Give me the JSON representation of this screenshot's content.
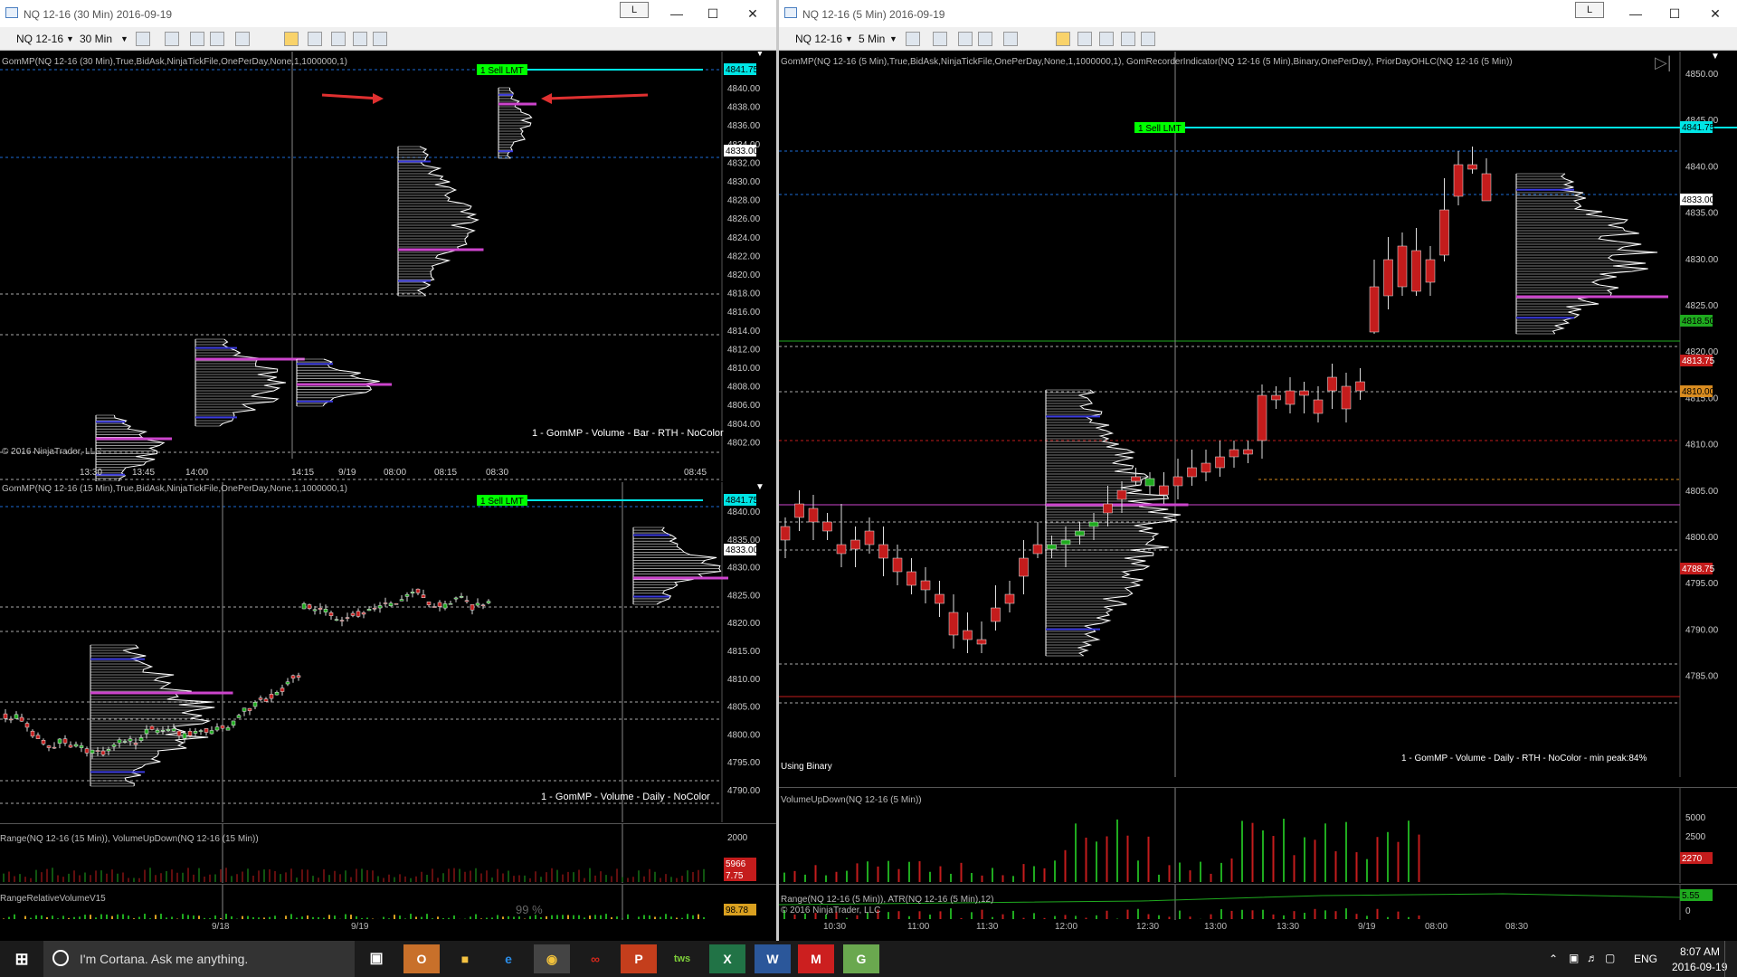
{
  "left_window": {
    "title": "NQ 12-16 (30 Min)  2016-09-19",
    "toolbar": {
      "instrument": "NQ 12-16",
      "interval": "30 Min"
    },
    "btn_l": "L",
    "top_chart": {
      "indicator": "GomMP(NQ 12-16 (30 Min),True,BidAsk,NinjaTickFile,OnePerDay,None,1,1000000,1)",
      "footer": "1 - GomMP - Volume - Bar - RTH - NoColor",
      "copyright": "© 2016 NinjaTrader, LLC",
      "order": "1  Sell LMT",
      "price_tag_current": "4833.00",
      "price_tag_order": "4841.75",
      "y_ticks": [
        "4840.00",
        "4838.00",
        "4836.00",
        "4834.00",
        "4832.00",
        "4830.00",
        "4828.00",
        "4826.00",
        "4824.00",
        "4822.00",
        "4820.00",
        "4818.00",
        "4816.00",
        "4814.00",
        "4812.00",
        "4810.00",
        "4808.00",
        "4806.00",
        "4804.00",
        "4802.00"
      ],
      "x_ticks": [
        "13:30",
        "13:45",
        "14:00",
        "14:15",
        "9/19",
        "08:00",
        "08:15",
        "08:30",
        "08:45"
      ]
    },
    "mid_chart": {
      "indicator": "GomMP(NQ 12-16 (15 Min),True,BidAsk,NinjaTickFile,OnePerDay,None,1,1000000,1)",
      "footer": "1 - GomMP - Volume - Daily - NoColor",
      "order": "1  Sell LMT",
      "price_tag_current": "4833.00",
      "price_tag_order": "4841.75",
      "y_ticks": [
        "4840.00",
        "4835.00",
        "4830.00",
        "4825.00",
        "4820.00",
        "4815.00",
        "4810.00",
        "4805.00",
        "4800.00",
        "4795.00",
        "4790.00"
      ]
    },
    "sub1": {
      "label": "Range(NQ 12-16 (15 Min)), VolumeUpDown(NQ 12-16 (15 Min))",
      "tag1": "5966",
      "tag2": "7.75",
      "tick": "2000"
    },
    "sub2": {
      "label": "RangeRelativeVolumeV15",
      "tag": "98.78",
      "overlay": "99 %"
    },
    "x_ticks": [
      "9/18",
      "9/19"
    ]
  },
  "right_window": {
    "title": "NQ 12-16 (5 Min)  2016-09-19",
    "toolbar": {
      "instrument": "NQ 12-16",
      "interval": "5 Min"
    },
    "btn_l": "L",
    "main_chart": {
      "indicator": "GomMP(NQ 12-16 (5 Min),True,BidAsk,NinjaTickFile,OnePerDay,None,1,1000000,1), GomRecorderIndicator(NQ 12-16 (5 Min),Binary,OnePerDay), PriorDayOHLC(NQ 12-16 (5 Min))",
      "footer": "1 - GomMP  - Volume - Daily - RTH - NoColor - min peak:84%",
      "using": "Using Binary",
      "order": "1  Sell LMT",
      "tags": {
        "order": "4841.75",
        "current": "4833.00",
        "t1": "4818.50",
        "t2": "4813.75",
        "t3": "4810.00",
        "t4": "4788.75"
      },
      "y_ticks": [
        "4850.00",
        "4845.00",
        "4840.00",
        "4835.00",
        "4830.00",
        "4825.00",
        "4820.00",
        "4815.00",
        "4810.00",
        "4805.00",
        "4800.00",
        "4795.00",
        "4790.00",
        "4785.00"
      ]
    },
    "vol_pane": {
      "label": "VolumeUpDown(NQ 12-16 (5 Min))",
      "ticks": [
        "5000",
        "2500",
        "0"
      ],
      "tag": "2270"
    },
    "range_pane": {
      "label": "Range(NQ 12-16 (5 Min)), ATR(NQ 12-16 (5 Min),12)",
      "copyright": "© 2016 NinjaTrader, LLC",
      "ticks": [
        "5",
        "0"
      ],
      "tag": "5.55"
    },
    "x_ticks": [
      "10:30",
      "11:00",
      "11:30",
      "12:00",
      "12:30",
      "13:00",
      "13:30",
      "9/19",
      "08:00",
      "08:30"
    ]
  },
  "taskbar": {
    "search": "I'm Cortana. Ask me anything.",
    "time": "8:07 AM",
    "date": "2016-09-19",
    "lang": "ENG"
  },
  "colors": {
    "bull": "#1faa1f",
    "bear": "#c41c1c",
    "poc": "#cc44cc",
    "va": "#3a3adc",
    "order": "#00ff00",
    "ordertag": "#00e5e5"
  }
}
